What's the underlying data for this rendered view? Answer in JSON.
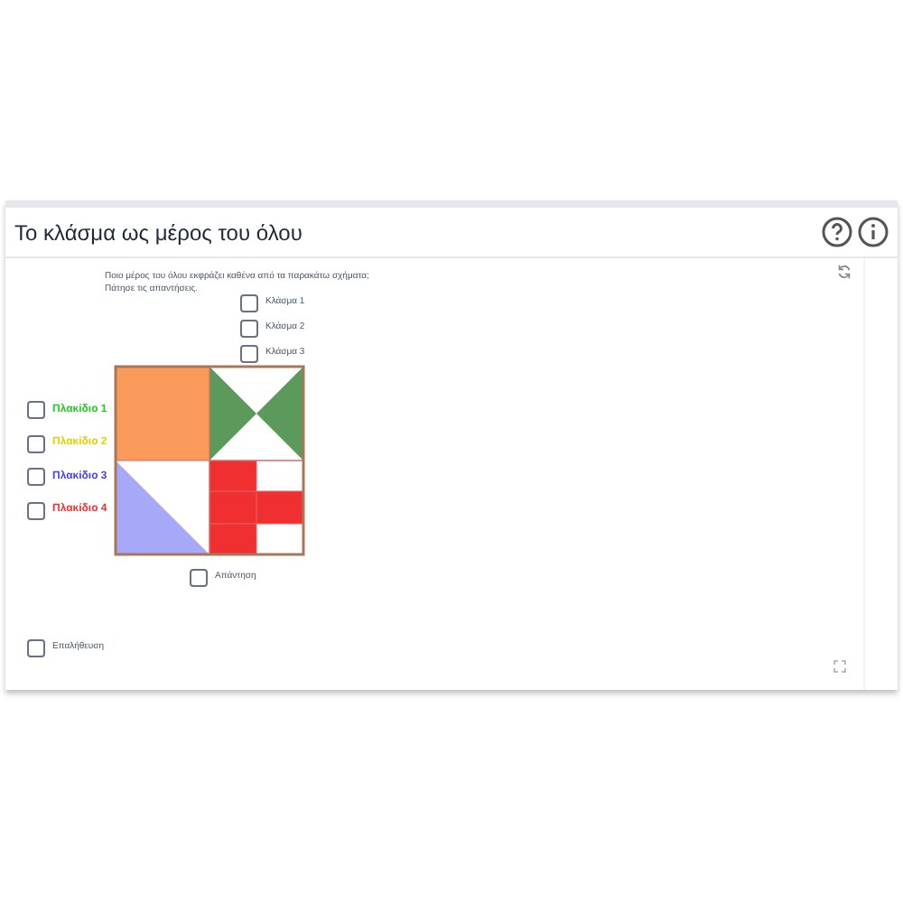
{
  "window": {
    "title": "Το κλάσμα ως μέρος του όλου"
  },
  "instructions": "Ποιο μέρος του όλου εκφράζει καθένα από τα παρακάτω σχήματα; Πάτησε τις απαντήσεις.",
  "fraction_options": [
    {
      "label": "Κλάσμα 1",
      "checked": false
    },
    {
      "label": "Κλάσμα 2",
      "checked": false
    },
    {
      "label": "Κλάσμα 3",
      "checked": false
    }
  ],
  "shape_options": [
    {
      "label": "Πλακίδιο 1",
      "checked": false,
      "color": "#22cc22"
    },
    {
      "label": "Πλακίδιο 2",
      "checked": false,
      "color": "#e6d000"
    },
    {
      "label": "Πλακίδιο 3",
      "checked": false,
      "color": "#4444ee"
    },
    {
      "label": "Πλακίδιο 4",
      "checked": false,
      "color": "#ee3333"
    }
  ],
  "answer_option": {
    "label": "Απάντηση",
    "checked": false
  },
  "verify_option": {
    "label": "Επαλήθευση",
    "checked": false
  }
}
